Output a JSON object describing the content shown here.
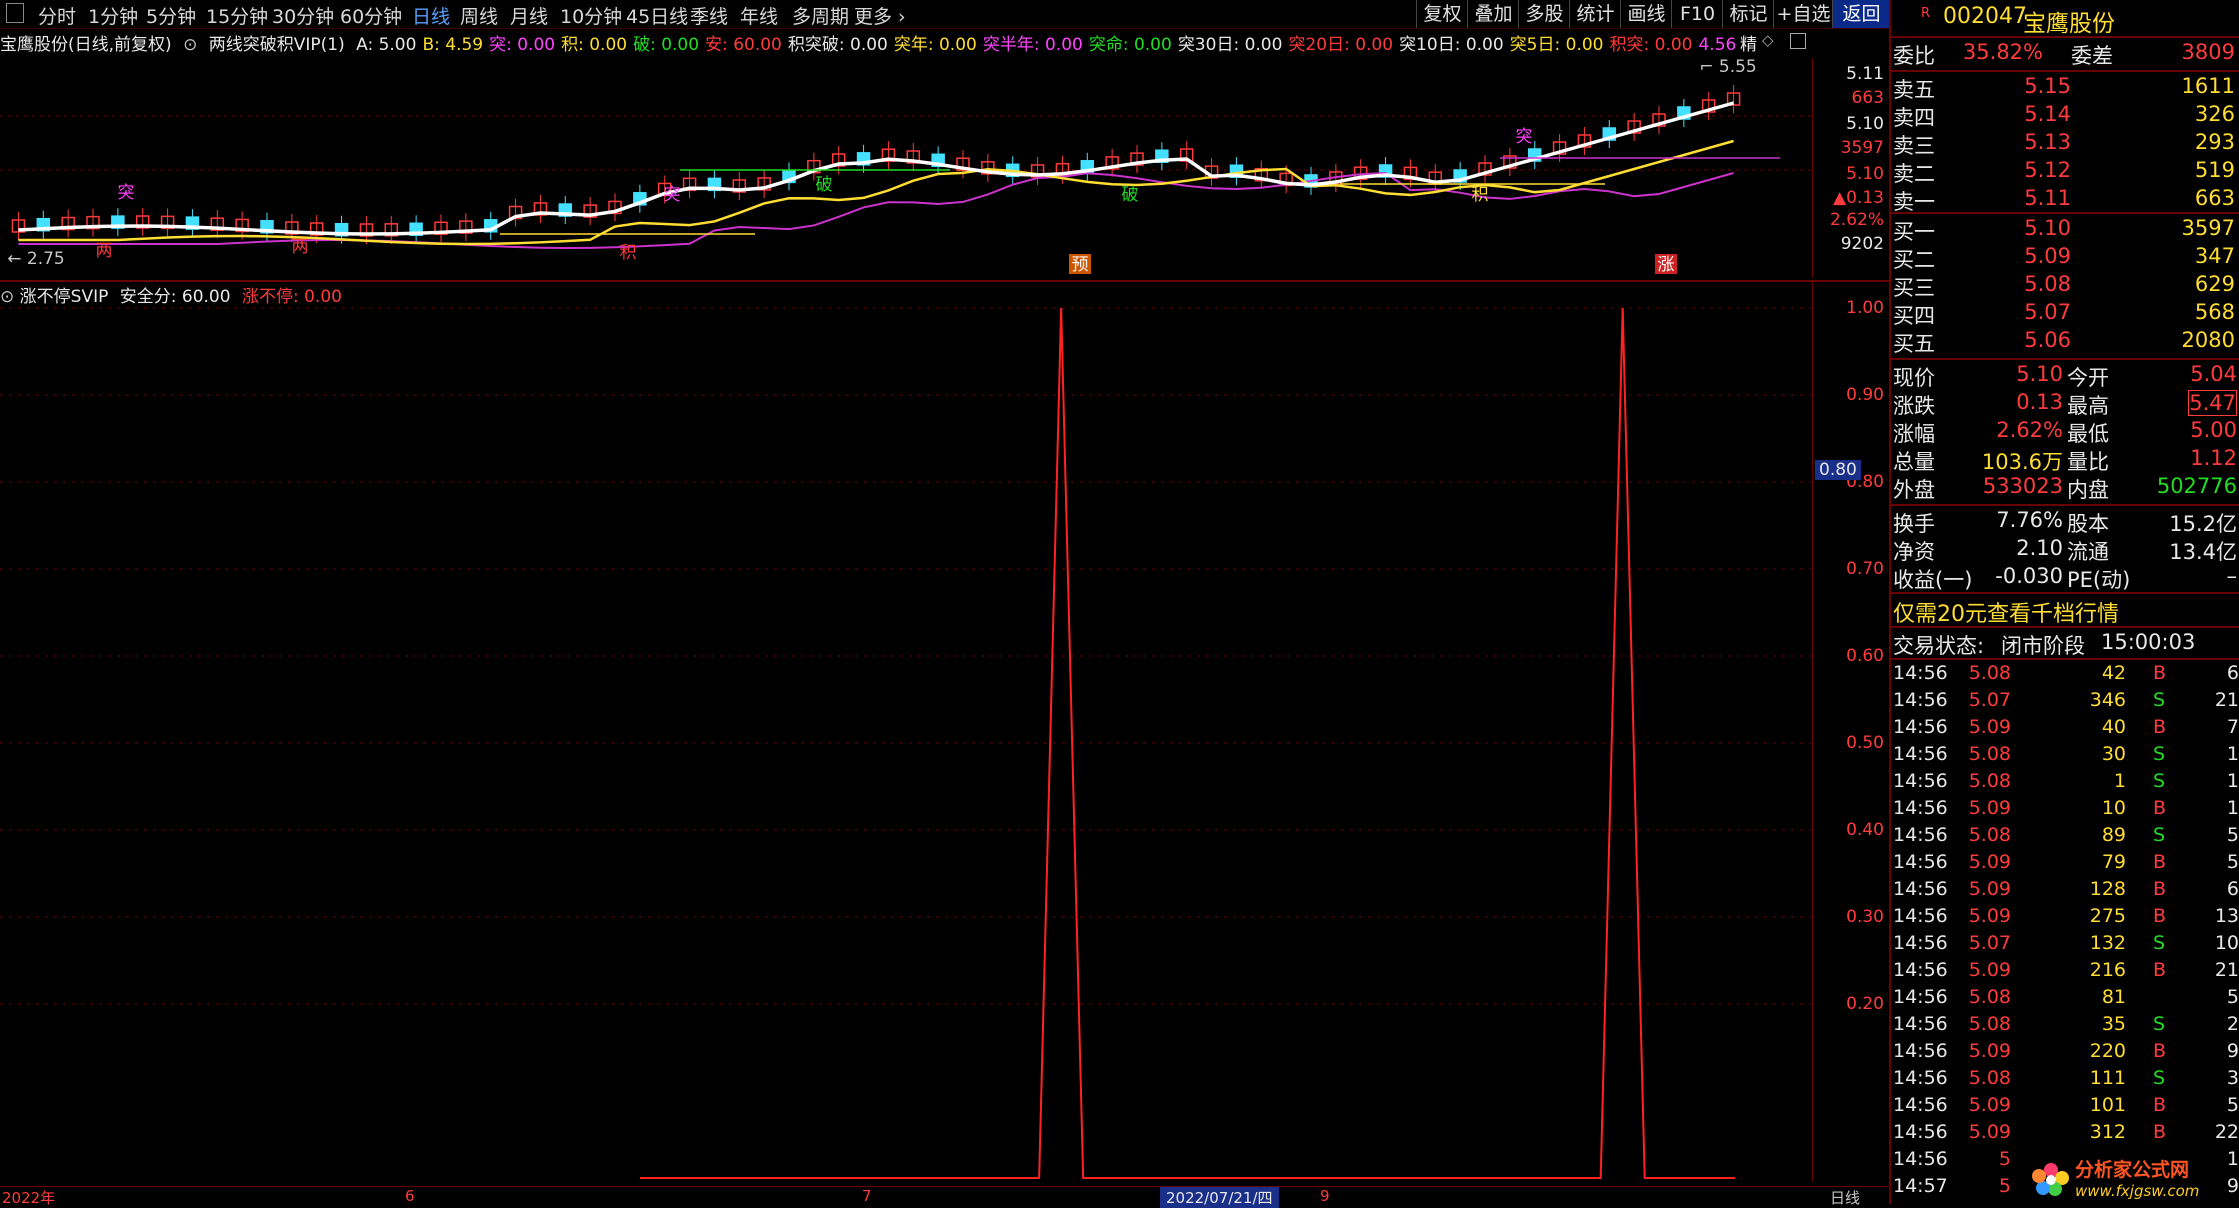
{
  "toolbar": {
    "periods": [
      "分时",
      "1分钟",
      "5分钟",
      "15分钟",
      "30分钟",
      "60分钟",
      "日线",
      "周线",
      "月线",
      "10分钟",
      "45日线",
      "季线",
      "年线",
      "多周期",
      "更多"
    ],
    "active_period": "日线",
    "right_buttons": [
      "复权",
      "叠加",
      "多股",
      "统计",
      "画线",
      "F10",
      "标记",
      "+自选",
      "返回"
    ],
    "active_right": "返回"
  },
  "indicator_line": {
    "stock_label": "宝鹰股份(日线,前复权)",
    "formula": "两线突破积VIP(1)",
    "items": [
      {
        "k": "A:",
        "v": "5.00",
        "c": "#e8e8e8"
      },
      {
        "k": "B:",
        "v": "4.59",
        "c": "#ffdd33"
      },
      {
        "k": "突:",
        "v": "0.00",
        "c": "#ff44ff"
      },
      {
        "k": "积:",
        "v": "0.00",
        "c": "#ffdd33"
      },
      {
        "k": "破:",
        "v": "0.00",
        "c": "#22dd22"
      },
      {
        "k": "安:",
        "v": "60.00",
        "c": "#ff3b3b"
      },
      {
        "k": "积突破:",
        "v": "0.00",
        "c": "#e8e8e8"
      },
      {
        "k": "突年:",
        "v": "0.00",
        "c": "#ffdd33"
      },
      {
        "k": "突半年:",
        "v": "0.00",
        "c": "#ff44ff"
      },
      {
        "k": "突命:",
        "v": "0.00",
        "c": "#22dd22"
      },
      {
        "k": "突30日:",
        "v": "0.00",
        "c": "#e8e8e8"
      },
      {
        "k": "突20日:",
        "v": "0.00",
        "c": "#ff3b3b"
      },
      {
        "k": "突10日:",
        "v": "0.00",
        "c": "#e8e8e8"
      },
      {
        "k": "突5日:",
        "v": "0.00",
        "c": "#ffdd33"
      },
      {
        "k": "积突:",
        "v": "0.00",
        "c": "#ff3b3b"
      },
      {
        "k": "",
        "v": "4.56",
        "c": "#ff44ff"
      }
    ],
    "jing": "精"
  },
  "main_chart": {
    "price_labels": [
      "5.11",
      "663",
      "5.10",
      "3597",
      "5.10",
      "▲0.13",
      "2.62%",
      "9202"
    ],
    "low_mark": "← 2.75",
    "high_mark": "5.55",
    "markers": {
      "tu": "突",
      "po": "破",
      "ji": "积",
      "liang": "两",
      "yu": "预",
      "zhang": "涨"
    }
  },
  "sub_chart": {
    "title": "涨不停SVIP",
    "safe_label": "安全分:",
    "safe_value": "60.00",
    "red_label": "涨不停:",
    "red_value": "0.00",
    "y_ticks": [
      "1.00",
      "0.90",
      "0.80",
      "0.70",
      "0.60",
      "0.50",
      "0.40",
      "0.30",
      "0.20"
    ],
    "highlight_value": "0.80",
    "signal": [
      0,
      0,
      0,
      0,
      0,
      0,
      0,
      0,
      0,
      0,
      0,
      0,
      0,
      0,
      0,
      0,
      0,
      0,
      0,
      0,
      0,
      0,
      0,
      0,
      0,
      0,
      0,
      0,
      0,
      0,
      1,
      0,
      0,
      0,
      0,
      0,
      0,
      0,
      0,
      0,
      0,
      0,
      0,
      0,
      0,
      0,
      0,
      0,
      0,
      0,
      0,
      0,
      0,
      0,
      0,
      0,
      0,
      0,
      0,
      0,
      0,
      0,
      0,
      0,
      0,
      0,
      0,
      0,
      0,
      0,
      1,
      0,
      0,
      0,
      0,
      0,
      0,
      0,
      0
    ],
    "date_bar": [
      "2022年",
      "6",
      "7",
      "2022/07/21/四",
      "9"
    ],
    "bottom_right": "日线"
  },
  "right_panel": {
    "code": "002047",
    "name": "宝鹰股份",
    "r_badge": "R",
    "weibi_label": "委比",
    "weibi": "35.82%",
    "weicha_label": "委差",
    "weicha": "3809",
    "asks": [
      {
        "l": "卖五",
        "p": "5.15",
        "v": "1611"
      },
      {
        "l": "卖四",
        "p": "5.14",
        "v": "326"
      },
      {
        "l": "卖三",
        "p": "5.13",
        "v": "293"
      },
      {
        "l": "卖二",
        "p": "5.12",
        "v": "519"
      },
      {
        "l": "卖一",
        "p": "5.11",
        "v": "663"
      }
    ],
    "bids": [
      {
        "l": "买一",
        "p": "5.10",
        "v": "3597"
      },
      {
        "l": "买二",
        "p": "5.09",
        "v": "347"
      },
      {
        "l": "买三",
        "p": "5.08",
        "v": "629"
      },
      {
        "l": "买四",
        "p": "5.07",
        "v": "568"
      },
      {
        "l": "买五",
        "p": "5.06",
        "v": "2080"
      }
    ],
    "stats": [
      {
        "l1": "现价",
        "v1": "5.10",
        "c1": "#ff3b3b",
        "l2": "今开",
        "v2": "5.04",
        "c2": "#ff3b3b"
      },
      {
        "l1": "涨跌",
        "v1": "0.13",
        "c1": "#ff3b3b",
        "l2": "最高",
        "v2": "5.47",
        "c2": "#ff3b3b"
      },
      {
        "l1": "涨幅",
        "v1": "2.62%",
        "c1": "#ff3b3b",
        "l2": "最低",
        "v2": "5.00",
        "c2": "#ff3b3b"
      },
      {
        "l1": "总量",
        "v1": "103.6万",
        "c1": "#ffdd33",
        "l2": "量比",
        "v2": "1.12",
        "c2": "#ff3b3b"
      },
      {
        "l1": "外盘",
        "v1": "533023",
        "c1": "#ff3b3b",
        "l2": "内盘",
        "v2": "502776",
        "c2": "#22dd22"
      }
    ],
    "stats2": [
      {
        "l1": "换手",
        "v1": "7.76%",
        "l2": "股本",
        "v2": "15.2亿"
      },
      {
        "l1": "净资",
        "v1": "2.10",
        "l2": "流通",
        "v2": "13.4亿"
      },
      {
        "l1": "收益(一)",
        "v1": "-0.030",
        "l2": "PE(动)",
        "v2": "–"
      }
    ],
    "promo": "仅需20元查看千档行情",
    "trade_state_label": "交易状态:",
    "trade_state": "闭市阶段",
    "trade_time": "15:00:03",
    "ticks": [
      {
        "t": "14:56",
        "p": "5.08",
        "v": "42",
        "s": "B",
        "n": "6"
      },
      {
        "t": "14:56",
        "p": "5.07",
        "v": "346",
        "s": "S",
        "n": "21"
      },
      {
        "t": "14:56",
        "p": "5.09",
        "v": "40",
        "s": "B",
        "n": "7"
      },
      {
        "t": "14:56",
        "p": "5.08",
        "v": "30",
        "s": "S",
        "n": "1"
      },
      {
        "t": "14:56",
        "p": "5.08",
        "v": "1",
        "s": "S",
        "n": "1"
      },
      {
        "t": "14:56",
        "p": "5.09",
        "v": "10",
        "s": "B",
        "n": "1"
      },
      {
        "t": "14:56",
        "p": "5.08",
        "v": "89",
        "s": "S",
        "n": "5"
      },
      {
        "t": "14:56",
        "p": "5.09",
        "v": "79",
        "s": "B",
        "n": "5"
      },
      {
        "t": "14:56",
        "p": "5.09",
        "v": "128",
        "s": "B",
        "n": "6"
      },
      {
        "t": "14:56",
        "p": "5.09",
        "v": "275",
        "s": "B",
        "n": "13"
      },
      {
        "t": "14:56",
        "p": "5.07",
        "v": "132",
        "s": "S",
        "n": "10"
      },
      {
        "t": "14:56",
        "p": "5.09",
        "v": "216",
        "s": "B",
        "n": "21"
      },
      {
        "t": "14:56",
        "p": "5.08",
        "v": "81",
        "s": "",
        "n": "5"
      },
      {
        "t": "14:56",
        "p": "5.08",
        "v": "35",
        "s": "S",
        "n": "2"
      },
      {
        "t": "14:56",
        "p": "5.09",
        "v": "220",
        "s": "B",
        "n": "9"
      },
      {
        "t": "14:56",
        "p": "5.08",
        "v": "111",
        "s": "S",
        "n": "3"
      },
      {
        "t": "14:56",
        "p": "5.09",
        "v": "101",
        "s": "B",
        "n": "5"
      },
      {
        "t": "14:56",
        "p": "5.09",
        "v": "312",
        "s": "B",
        "n": "22"
      },
      {
        "t": "14:56",
        "p": "5",
        "v": "",
        "s": "",
        "n": "1"
      },
      {
        "t": "14:57",
        "p": "5",
        "v": "",
        "s": "",
        "n": "9"
      }
    ],
    "watermark_cn": "分析家公式网",
    "watermark_url": "www.fxjgsw.com"
  }
}
